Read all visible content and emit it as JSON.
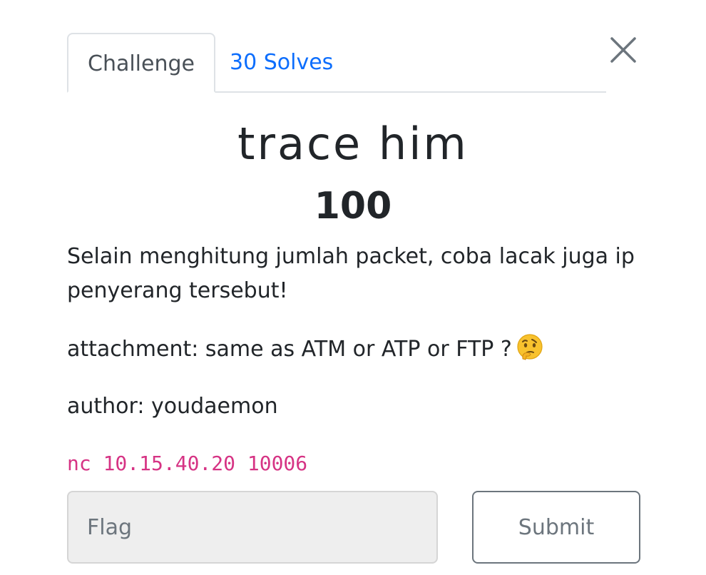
{
  "tabs": {
    "challenge_label": "Challenge",
    "solves_label": "30 Solves"
  },
  "challenge": {
    "name": "trace him",
    "points": "100",
    "description_line1": "Selain menghitung jumlah packet, coba lacak juga ip penyerang tersebut!",
    "attachment": "attachment: same as ATM or ATP or FTP ?",
    "author": "author: youdaemon",
    "connection": "nc 10.15.40.20 10006"
  },
  "form": {
    "flag_placeholder": "Flag",
    "flag_value": "",
    "submit_label": "Submit"
  },
  "icons": {
    "close": "close-icon",
    "thinking": "thinking-face-emoji"
  },
  "colors": {
    "link_blue": "#0d6efd",
    "code_pink": "#d63384",
    "text_dark": "#212529"
  }
}
